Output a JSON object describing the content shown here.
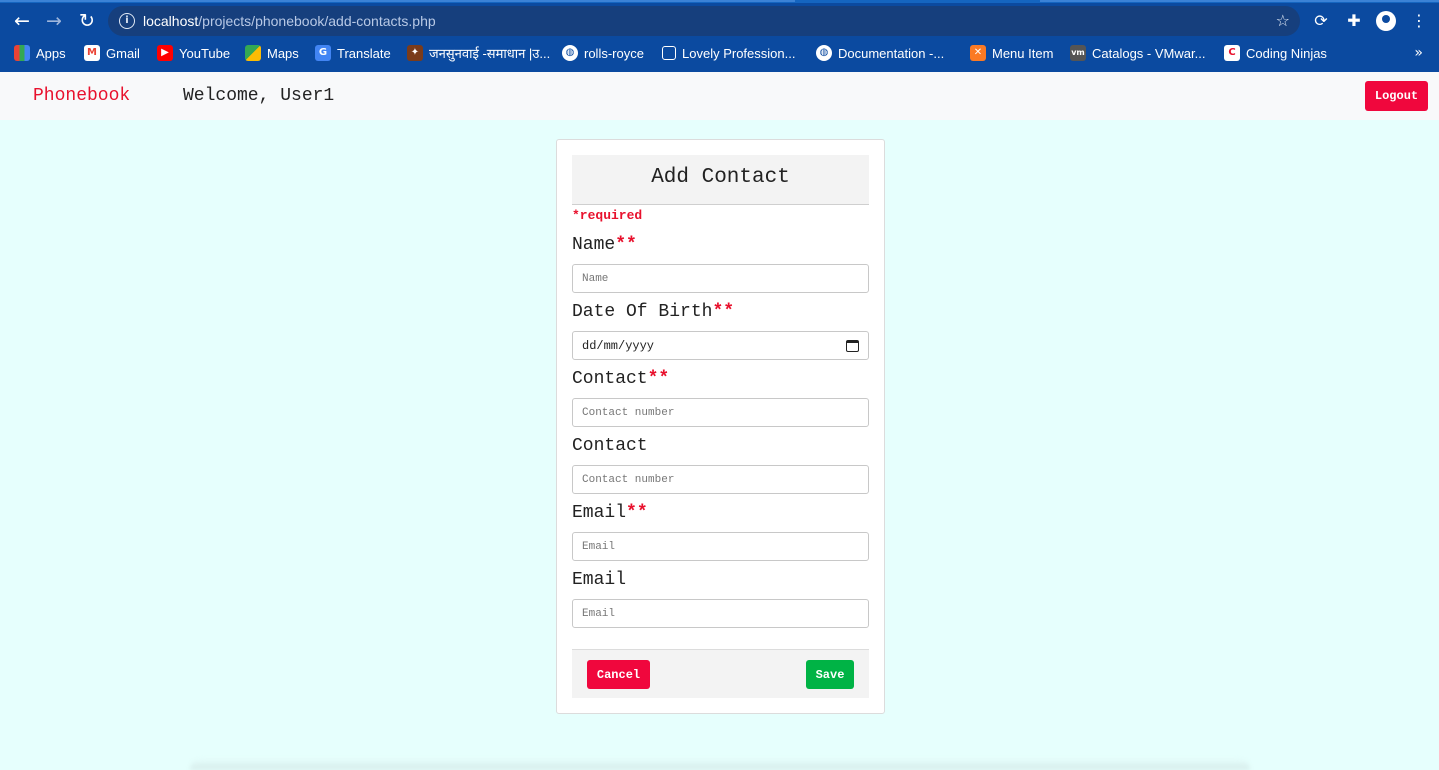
{
  "browser": {
    "url_host": "localhost",
    "url_path": "/projects/phonebook/add-contacts.php",
    "bookmarks": [
      {
        "label": "Apps",
        "icon": "apps-grid-icon"
      },
      {
        "label": "Gmail",
        "icon": "gmail-icon"
      },
      {
        "label": "YouTube",
        "icon": "youtube-icon"
      },
      {
        "label": "Maps",
        "icon": "maps-icon"
      },
      {
        "label": "Translate",
        "icon": "translate-icon"
      },
      {
        "label": "जनसुनवाई -समाधान |उ...",
        "icon": "emblem-icon"
      },
      {
        "label": "rolls-royce",
        "icon": "globe-icon"
      },
      {
        "label": "Lovely Profession...",
        "icon": "external-link-icon"
      },
      {
        "label": "Documentation -...",
        "icon": "globe-icon"
      },
      {
        "label": "Menu Item",
        "icon": "xampp-icon"
      },
      {
        "label": "Catalogs - VMwar...",
        "icon": "vm-icon"
      },
      {
        "label": "Coding Ninjas",
        "icon": "coding-ninjas-icon"
      }
    ],
    "more_label": "»"
  },
  "navbar": {
    "brand": "Phonebook",
    "welcome": "Welcome, User1",
    "logout_label": "Logout"
  },
  "form": {
    "title": "Add Contact",
    "required_note": "*required",
    "required_mark": "**",
    "name_label": "Name",
    "name_placeholder": "Name",
    "dob_label": "Date Of Birth",
    "dob_placeholder": "dd/mm/yyyy",
    "contact1_label": "Contact",
    "contact1_placeholder": "Contact number",
    "contact2_label": "Contact",
    "contact2_placeholder": "Contact number",
    "email1_label": "Email",
    "email1_placeholder": "Email",
    "email2_label": "Email",
    "email2_placeholder": "Email",
    "cancel_label": "Cancel",
    "save_label": "Save"
  },
  "colors": {
    "accent_red": "#f0073d",
    "brand_red": "#e8112d",
    "save_green": "#00b345",
    "page_background": "#e6fffd",
    "browser_blue": "#0b4aa0"
  }
}
